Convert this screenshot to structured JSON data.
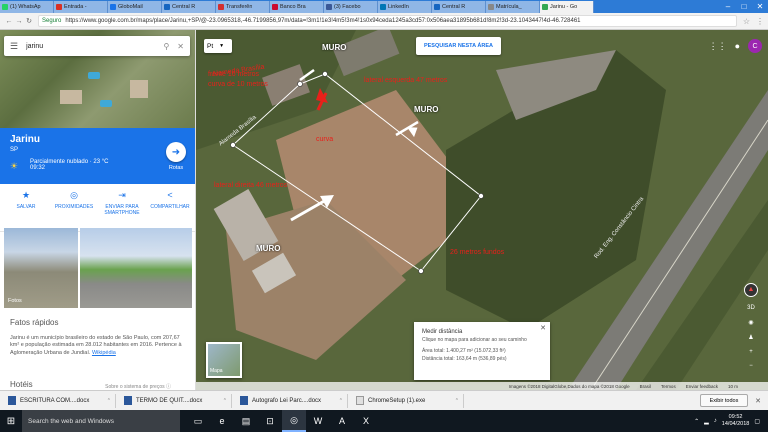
{
  "tabs": [
    {
      "label": "(1) WhatsAp",
      "color": "#25d366",
      "active": false
    },
    {
      "label": "Entrada - ",
      "color": "#d93025",
      "active": false
    },
    {
      "label": "GloboMail",
      "color": "#1a73e8",
      "active": false
    },
    {
      "label": "Central R",
      "color": "#1565c0",
      "active": false
    },
    {
      "label": "Transferên",
      "color": "#d32f2f",
      "active": false
    },
    {
      "label": "Banco Bra",
      "color": "#cc092f",
      "active": false
    },
    {
      "label": "(3) Facebo",
      "color": "#3b5998",
      "active": false
    },
    {
      "label": "LinkedIn",
      "color": "#0077b5",
      "active": false
    },
    {
      "label": "Central R",
      "color": "#1565c0",
      "active": false
    },
    {
      "label": "Matrícula_",
      "color": "#888888",
      "active": false
    },
    {
      "label": "Jarinu - Go",
      "color": "#34a853",
      "active": true
    }
  ],
  "address": {
    "secure_label": "Seguro",
    "url": "https://www.google.com.br/maps/place/Jarinu,+SP/@-23.0965318,-46.7199856,97m/data=!3m1!1e3!4m5!3m4!1s0x94ceda1245a3cd57:0x506aea31895b681d!8m2!3d-23.1043447!4d-46.728461"
  },
  "panel": {
    "search_value": "jarinu",
    "place_name": "Jarinu",
    "state": "SP",
    "weather": "Parcialmente nublado · 23 °C",
    "time": "09:32",
    "routes_label": "Rotas",
    "actions": [
      {
        "icon": "★",
        "label": "SALVAR",
        "name": "save"
      },
      {
        "icon": "◎",
        "label": "PROXIMIDADES",
        "name": "nearby"
      },
      {
        "icon": "⇥",
        "label": "ENVIAR PARA SMARTPHONE",
        "name": "send-to-phone"
      },
      {
        "icon": "<",
        "label": "COMPARTILHAR",
        "name": "share"
      }
    ],
    "photos_label": "Fotos",
    "facts_title": "Fatos rápidos",
    "facts_text": "Jarinu é um município brasileiro do estado de São Paulo, com 207,67 km² e população estimada em 28.012 habitantes em 2016. Pertence à Aglomeração Urbana de Jundiaí. ",
    "facts_link": "Wikipédia",
    "hotels_title": "Hotéis",
    "hotels_link": "Sobre o sistema de preços ⓘ"
  },
  "map": {
    "layer_value": "Pt",
    "search_area_label": "PESQUISAR NESTA ÁREA",
    "avatar_letter": "C",
    "street_1": "Alameda Brasília",
    "street_2": "Alameda Brasília",
    "road": "Rod. Eng. Constâncio Cintra",
    "annotations": {
      "muro_top": "MURO",
      "muro_right": "MURO",
      "muro_bottom": "MURO",
      "frente": "frente 16 metros",
      "curva_metros": "curva de 10 metros",
      "curva": "curva",
      "lateral_esquerda": "lateral esquerda 47 metros",
      "lateral_direita": "lateral direita 46 metros",
      "fundos": "26 metros fundos"
    },
    "measure": {
      "title": "Medir distância",
      "hint": "Clique no mapa para adicionar ao seu caminho",
      "area": "Área total: 1.400,27 m² (15.072,33 ft²)",
      "distance": "Distância total: 163,64 m (536,89 pés)"
    },
    "layers_label": "Mapa",
    "zoom_3d": "3D",
    "footer": [
      "Imagens ©2018 DigitalGlobe,Dados do mapa ©2018 Google",
      "Brasil",
      "Termos",
      "Enviar feedback",
      "10 m"
    ]
  },
  "downloads": {
    "items": [
      {
        "label": "ESCRITURA COM....docx"
      },
      {
        "label": "TERMO DE QUIT....docx"
      },
      {
        "label": "Autografo Lei Parc....docx"
      },
      {
        "label": "ChromeSetup (1).exe"
      }
    ],
    "show_all": "Exibir todos"
  },
  "taskbar": {
    "search_placeholder": "Search the web and Windows",
    "time": "09:52",
    "date": "14/04/2018"
  }
}
